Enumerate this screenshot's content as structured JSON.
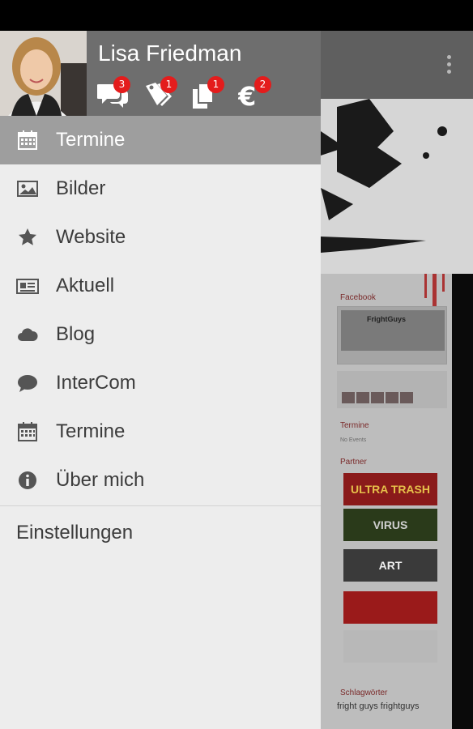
{
  "user": {
    "name": "Lisa Friedman"
  },
  "header_icons": [
    {
      "icon": "chat-bubbles-icon",
      "badge": "3"
    },
    {
      "icon": "tags-icon",
      "badge": "1"
    },
    {
      "icon": "copy-pages-icon",
      "badge": "1"
    },
    {
      "icon": "euro-icon",
      "badge": "2"
    }
  ],
  "nav": {
    "items": [
      {
        "label": "Termine",
        "icon": "calendar-icon",
        "active": true
      },
      {
        "label": "Bilder",
        "icon": "image-icon",
        "active": false
      },
      {
        "label": "Website",
        "icon": "star-icon",
        "active": false
      },
      {
        "label": "Aktuell",
        "icon": "newspaper-icon",
        "active": false
      },
      {
        "label": "Blog",
        "icon": "cloud-icon",
        "active": false
      },
      {
        "label": "InterCom",
        "icon": "chat-icon",
        "active": false
      },
      {
        "label": "Termine",
        "icon": "calendar-icon",
        "active": false
      },
      {
        "label": "Über mich",
        "icon": "info-icon",
        "active": false
      }
    ],
    "settings_label": "Einstellungen"
  },
  "background": {
    "facebook_label": "Facebook",
    "fb_page_name": "FrightGuys",
    "termine_label": "Termine",
    "termine_sub": "No Events",
    "partner_label": "Partner",
    "banners": [
      "ULTRA TRASH",
      "VIRUS",
      "ART",
      "",
      ""
    ],
    "tags_label": "Schlagwörter",
    "tags_text": "fright guys frightguys"
  },
  "colors": {
    "header_bg": "#6e6e6e",
    "active_item_bg": "#9e9e9e",
    "drawer_bg": "#ededed",
    "badge_red": "#e41c1c"
  }
}
